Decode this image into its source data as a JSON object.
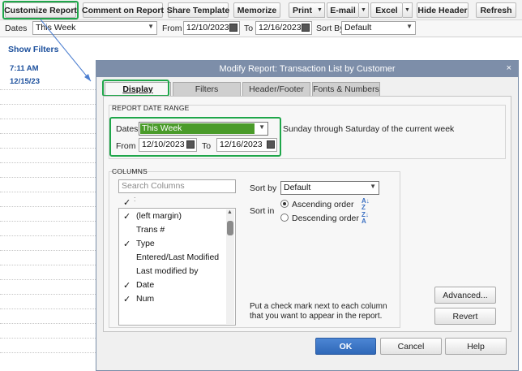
{
  "toolbar": {
    "customize": "Customize Report",
    "comment": "Comment on Report",
    "share": "Share Template",
    "memorize": "Memorize",
    "print": "Print",
    "email": "E-mail",
    "excel": "Excel",
    "hide_header": "Hide Header",
    "refresh": "Refresh"
  },
  "filterbar": {
    "dates_label": "Dates",
    "dates_value": "This Week",
    "from_label": "From",
    "from_value": "12/10/2023",
    "to_label": "To",
    "to_value": "12/16/2023",
    "sortby_label": "Sort By",
    "sortby_value": "Default"
  },
  "left": {
    "show_filters": "Show Filters",
    "time": "7:11 AM",
    "date": "12/15/23"
  },
  "dialog": {
    "title": "Modify Report: Transaction List by Customer",
    "close": "×",
    "tabs": [
      "Display",
      "Filters",
      "Header/Footer",
      "Fonts & Numbers"
    ],
    "date_range": {
      "group_title": "REPORT DATE RANGE",
      "dates_label": "Dates",
      "dates_value": "This Week",
      "description": "Sunday through Saturday of the current week",
      "from_label": "From",
      "from_value": "12/10/2023",
      "to_label": "To",
      "to_value": "12/16/2023"
    },
    "columns": {
      "group_title": "COLUMNS",
      "search_placeholder": "Search Columns",
      "header_check": "✓",
      "items": [
        {
          "checked": true,
          "name": "(left margin)"
        },
        {
          "checked": false,
          "name": "Trans #"
        },
        {
          "checked": true,
          "name": "Type"
        },
        {
          "checked": false,
          "name": "Entered/Last Modified"
        },
        {
          "checked": false,
          "name": "Last modified by"
        },
        {
          "checked": true,
          "name": "Date"
        },
        {
          "checked": true,
          "name": "Num"
        }
      ],
      "sort_by_label": "Sort by",
      "sort_by_value": "Default",
      "sort_in_label": "Sort in",
      "ascending": "Ascending order",
      "descending": "Descending order",
      "hint": "Put a check mark next to each column that you want to appear in the report."
    },
    "buttons": {
      "advanced": "Advanced...",
      "revert": "Revert",
      "ok": "OK",
      "cancel": "Cancel",
      "help": "Help"
    }
  },
  "colors": {
    "highlight_green": "#1fa64a",
    "title_bar": "#7d8ea9",
    "selected_value": "#4a9b2a",
    "primary_button": "#2f68b8",
    "link_blue": "#1b4f9c"
  }
}
